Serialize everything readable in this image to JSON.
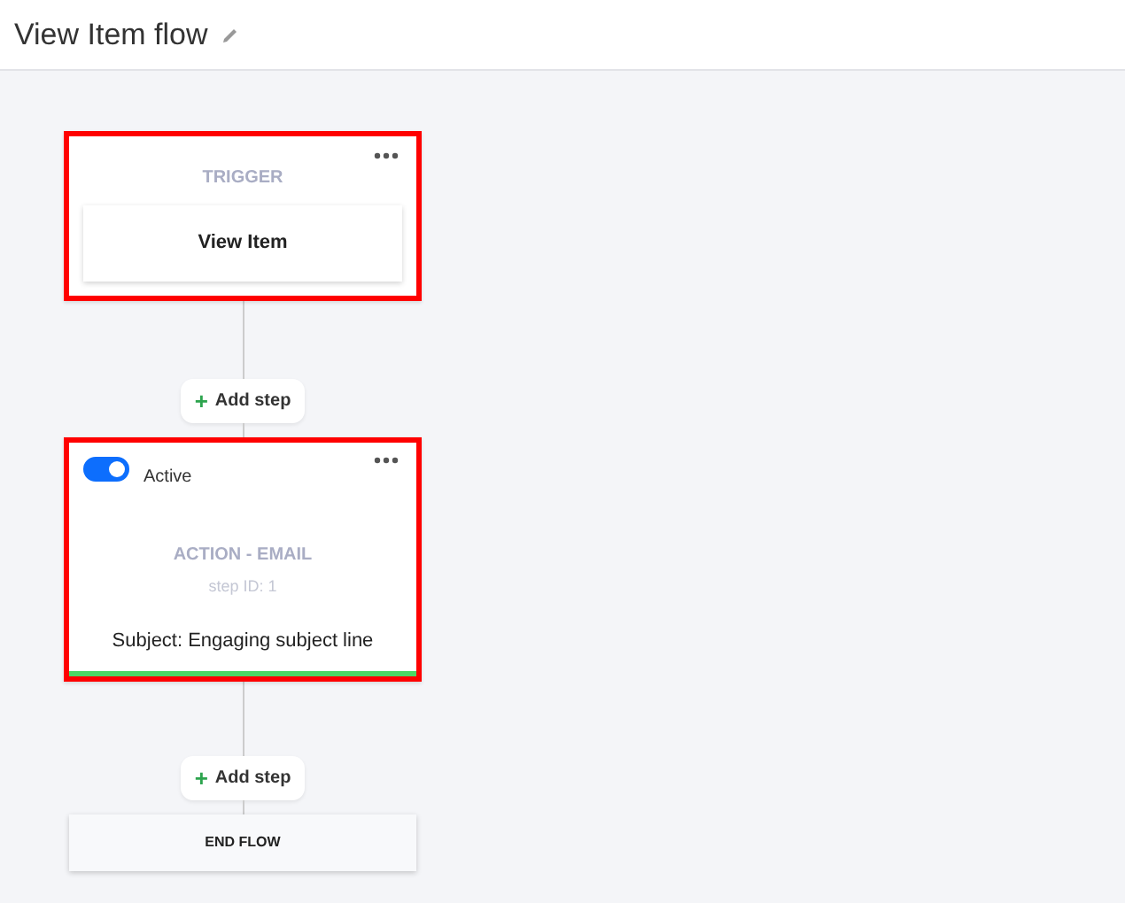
{
  "header": {
    "title": "View Item flow"
  },
  "steps": [
    {
      "kind": "trigger",
      "highlighted": true,
      "label": "TRIGGER",
      "name": "View Item"
    },
    {
      "kind": "add",
      "label": "Add step",
      "icon": "+"
    },
    {
      "kind": "action",
      "highlighted": true,
      "active": true,
      "toggle_label": "Active",
      "label": "ACTION - EMAIL",
      "step_id": "step ID: 1",
      "subject": "Subject: Engaging subject line"
    },
    {
      "kind": "add",
      "label": "Add step",
      "icon": "+"
    },
    {
      "kind": "end",
      "label": "END FLOW"
    }
  ]
}
